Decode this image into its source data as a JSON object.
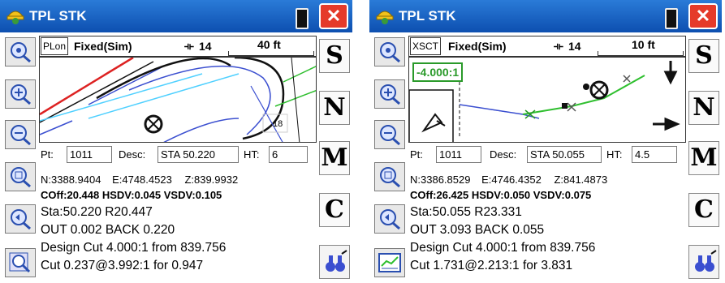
{
  "panels": [
    {
      "title": "TPL STK",
      "mode": "PLon",
      "fix": "Fixed(Sim)",
      "satellites": "14",
      "scale": "40 ft",
      "grade_readout": "",
      "map_number": "18",
      "pt_label": "Pt:",
      "pt_value": "1011",
      "desc_label": "Desc:",
      "desc_value": "STA 50.220",
      "ht_label": "HT:",
      "ht_value": "6",
      "coords": {
        "n": "N:3388.9404",
        "e": "E:4748.4523",
        "z": "Z:839.9932"
      },
      "offsets": "COff:20.448 HSDV:0.045 VSDV:0.105",
      "station": "Sta:50.220 R20.447",
      "out_back": "OUT 0.002 BACK 0.220",
      "design_cut": "Design Cut 4.000:1 from 839.756",
      "cut": "Cut 0.237@3.992:1 for 0.947",
      "side_buttons": [
        "S",
        "N",
        "M",
        "C"
      ],
      "tool_icons": [
        "zoom-extents-icon",
        "zoom-in-icon",
        "zoom-out-icon",
        "zoom-window-icon",
        "zoom-previous-icon",
        "zoom-realtime-icon"
      ]
    },
    {
      "title": "TPL STK",
      "mode": "XSCT",
      "fix": "Fixed(Sim)",
      "satellites": "14",
      "scale": "10 ft",
      "grade_readout": "-4.000:1",
      "map_number": "",
      "pt_label": "Pt:",
      "pt_value": "1011",
      "desc_label": "Desc:",
      "desc_value": "STA 50.055",
      "ht_label": "HT:",
      "ht_value": "4.5",
      "coords": {
        "n": "N:3386.8529",
        "e": "E:4746.4352",
        "z": "Z:841.4873"
      },
      "offsets": "COff:26.425 HSDV:0.050 VSDV:0.075",
      "station": "Sta:50.055 R23.331",
      "out_back": "OUT 3.093 BACK 0.055",
      "design_cut": "Design Cut 4.000:1 from 839.756",
      "cut": "Cut 1.731@2.213:1 for 3.831",
      "side_buttons": [
        "S",
        "N",
        "M",
        "C"
      ],
      "tool_icons": [
        "zoom-extents-icon",
        "zoom-in-icon",
        "zoom-out-icon",
        "zoom-window-icon",
        "zoom-previous-icon",
        "cross-section-icon"
      ]
    }
  ],
  "colors": {
    "titlebar": "#1a62c4",
    "close": "#e53a2a",
    "grade_readout": "#2a9a2a",
    "alignment_blue": "#3b4fd0",
    "alignment_green": "#2fbf2f"
  }
}
